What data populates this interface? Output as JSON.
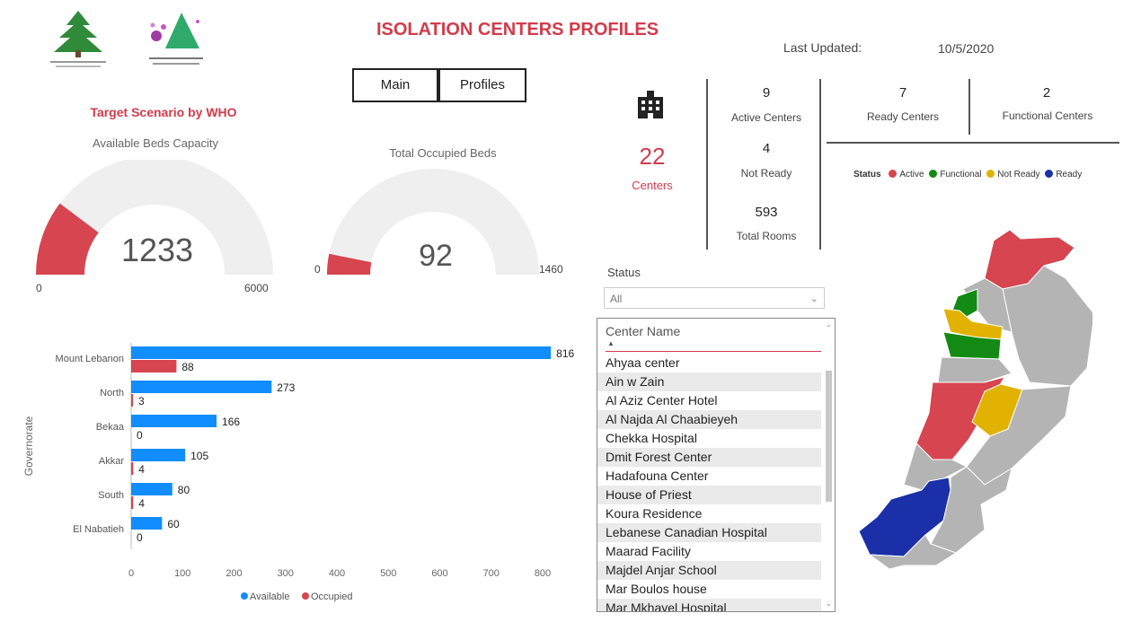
{
  "header": {
    "title": "ISOLATION CENTERS PROFILES",
    "last_updated_label": "Last Updated:",
    "last_updated_value": "10/5/2020"
  },
  "nav": {
    "main_label": "Main",
    "profiles_label": "Profiles"
  },
  "scenario_title": "Target Scenario by WHO",
  "gauges": {
    "available": {
      "title": "Available Beds Capacity",
      "value": "1233",
      "min": "0",
      "max": "6000",
      "fraction": 0.2055
    },
    "occupied": {
      "title": "Total Occupied Beds",
      "value": "92",
      "min": "0",
      "max": "1460",
      "fraction": 0.063
    }
  },
  "kpis": {
    "centers_value": "22",
    "centers_label": "Centers",
    "active_value": "9",
    "active_label": "Active Centers",
    "not_ready_value": "4",
    "not_ready_label": "Not Ready",
    "rooms_value": "593",
    "rooms_label": "Total Rooms",
    "ready_value": "7",
    "ready_label": "Ready Centers",
    "functional_value": "2",
    "functional_label": "Functional Centers"
  },
  "status_legend": {
    "title": "Status",
    "items": [
      {
        "label": "Active",
        "color": "#d64550"
      },
      {
        "label": "Functional",
        "color": "#138a13"
      },
      {
        "label": "Not Ready",
        "color": "#e2b200"
      },
      {
        "label": "Ready",
        "color": "#1a2fa8"
      }
    ]
  },
  "filter": {
    "label": "Status",
    "selected": "All"
  },
  "center_list": {
    "header": "Center Name",
    "items": [
      "Ahyaa center",
      "Ain w Zain",
      "Al Aziz Center Hotel",
      "Al Najda Al Chaabieyeh",
      "Chekka Hospital",
      "Dmit Forest Center",
      "Hadafouna Center",
      "House of Priest",
      "Koura Residence",
      "Lebanese Canadian Hospital",
      "Maarad Facility",
      "Majdel Anjar School",
      "Mar Boulos house",
      "Mar Mkhayel Hospital"
    ]
  },
  "chart_data": {
    "type": "bar",
    "orientation": "horizontal",
    "categories": [
      "Mount Lebanon",
      "North",
      "Bekaa",
      "Akkar",
      "South",
      "El Nabatieh"
    ],
    "series": [
      {
        "name": "Available",
        "color": "#118dff",
        "values": [
          816,
          273,
          166,
          105,
          80,
          60
        ]
      },
      {
        "name": "Occupied",
        "color": "#d64550",
        "values": [
          88,
          3,
          0,
          4,
          4,
          0
        ]
      }
    ],
    "ylabel": "Governorate",
    "xlim": [
      0,
      850
    ],
    "xticks": [
      0,
      100,
      200,
      300,
      400,
      500,
      600,
      700,
      800
    ],
    "legend": "bottom",
    "grid": false
  },
  "icons": {
    "building": "building-icon",
    "logo_left": "cedar-logo",
    "logo_right": "committee-logo"
  }
}
